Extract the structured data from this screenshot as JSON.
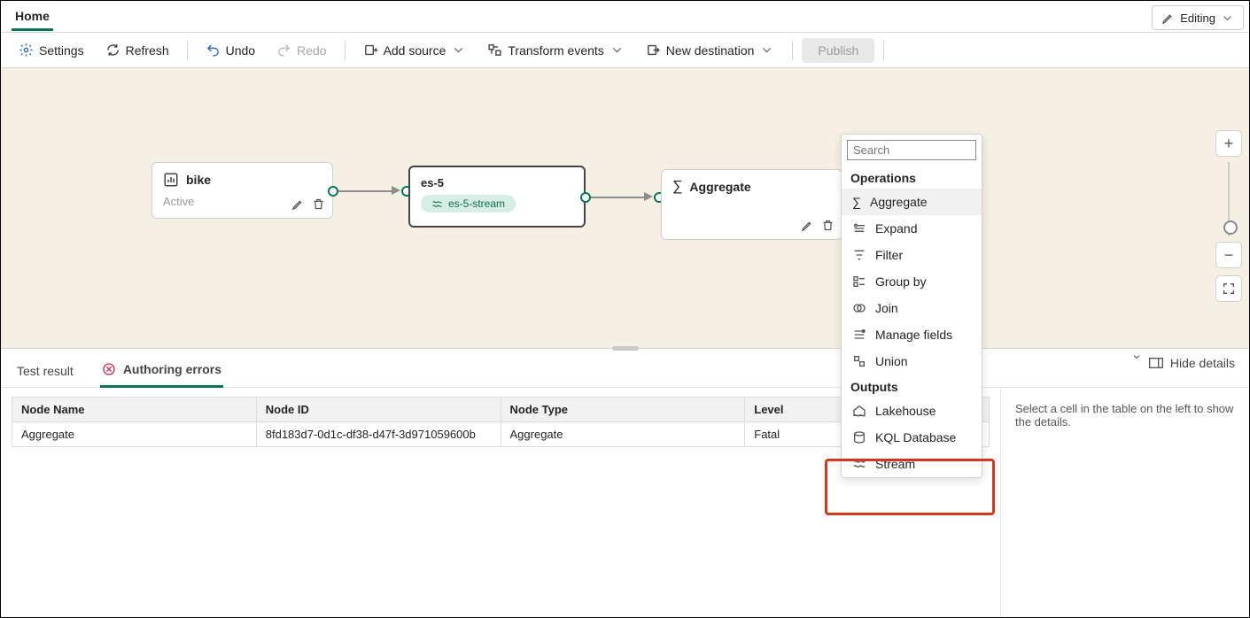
{
  "header": {
    "tab": "Home",
    "mode_label": "Editing"
  },
  "toolbar": {
    "settings": "Settings",
    "refresh": "Refresh",
    "undo": "Undo",
    "redo": "Redo",
    "add_source": "Add source",
    "transform": "Transform events",
    "new_destination": "New destination",
    "publish": "Publish"
  },
  "nodes": {
    "source": {
      "title": "bike",
      "subtitle": "Active"
    },
    "stream": {
      "title": "es-5",
      "pill": "es-5-stream"
    },
    "op": {
      "title": "Aggregate"
    }
  },
  "popup": {
    "search_placeholder": "Search",
    "group_operations": "Operations",
    "group_outputs": "Outputs",
    "operations": [
      "Aggregate",
      "Expand",
      "Filter",
      "Group by",
      "Join",
      "Manage fields",
      "Union"
    ],
    "outputs": [
      "Lakehouse",
      "KQL Database",
      "Stream"
    ]
  },
  "bottom": {
    "tab_test": "Test result",
    "tab_errors": "Authoring errors",
    "hide": "Hide details",
    "side_msg": "Select a cell in the table on the left to show the details.",
    "columns": [
      "Node Name",
      "Node ID",
      "Node Type",
      "Level"
    ],
    "rows": [
      {
        "name": "Aggregate",
        "id": "8fd183d7-0d1c-df38-d47f-3d971059600b",
        "type": "Aggregate",
        "level": "Fatal"
      }
    ]
  }
}
